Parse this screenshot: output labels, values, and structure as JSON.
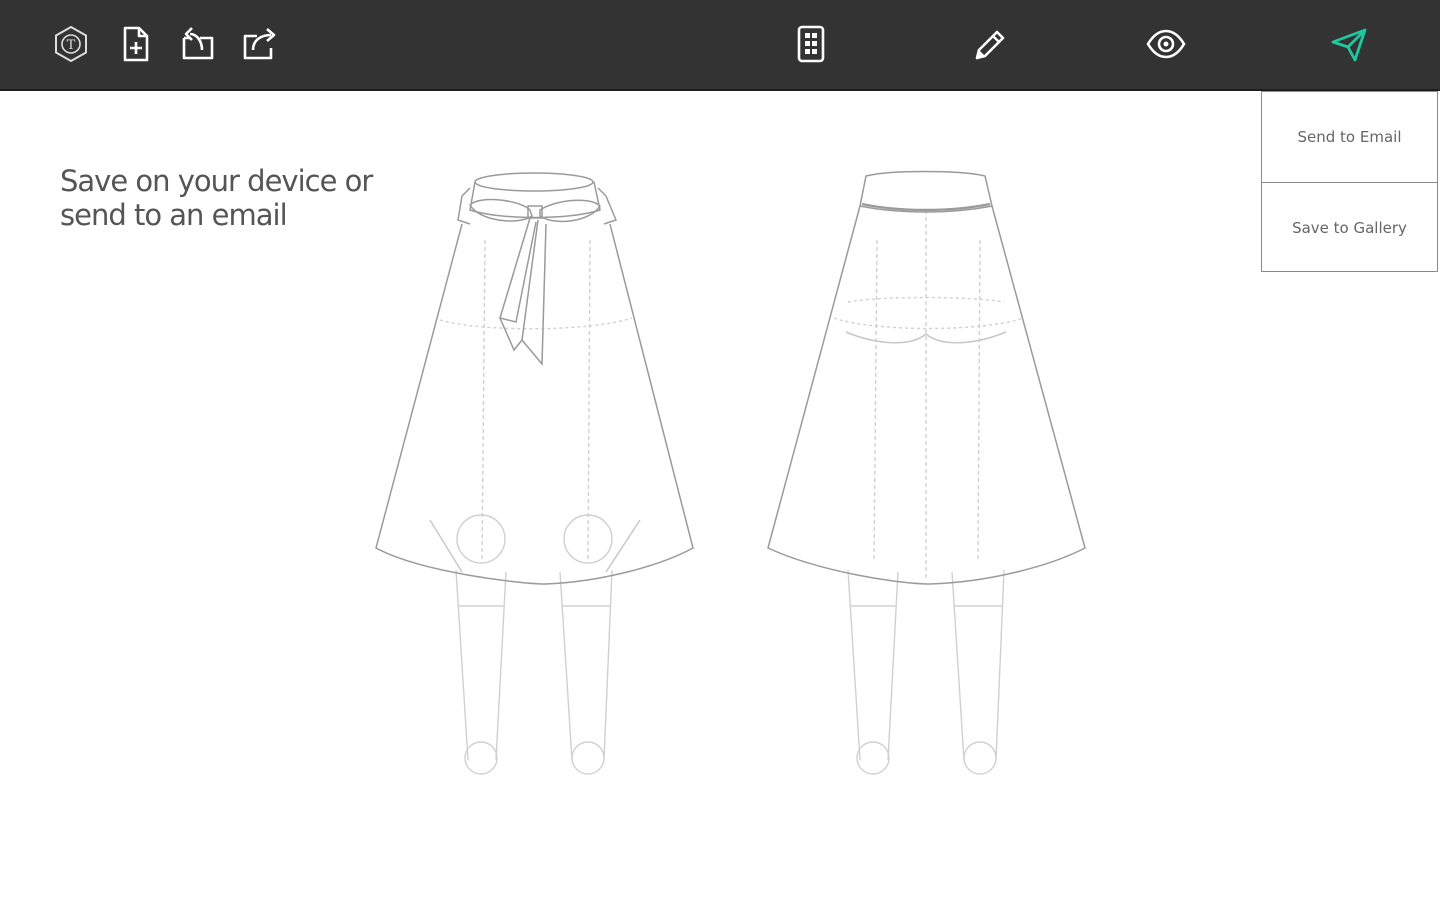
{
  "toolbar": {
    "icons": {
      "logo": "logo-icon",
      "new_file": "new-file-icon",
      "open": "open-folder-icon",
      "share": "share-icon",
      "layers": "layers-icon",
      "pencil": "pencil-icon",
      "preview": "eye-icon",
      "send": "paper-plane-icon"
    },
    "active_color": "#1ec8a0",
    "icon_color": "#ffffff"
  },
  "canvas": {
    "instruction": "Save on your device or\nsend to an email"
  },
  "send_menu": {
    "items": [
      {
        "label": "Send to Email"
      },
      {
        "label": "Save to Gallery"
      }
    ]
  }
}
